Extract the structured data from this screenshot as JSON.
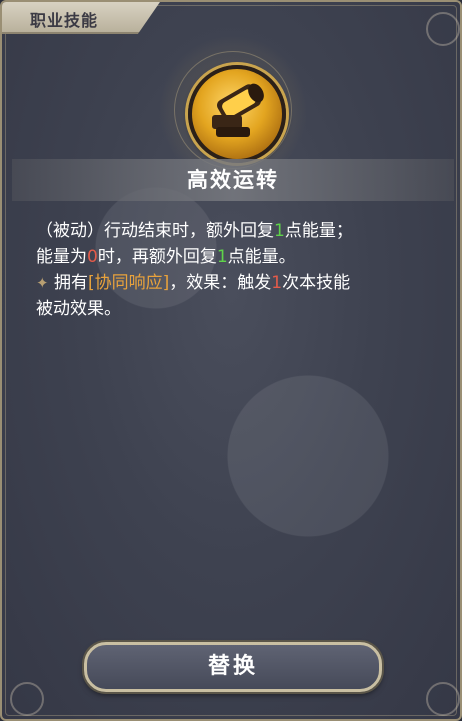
{
  "tab": {
    "label": "职业技能"
  },
  "skill": {
    "icon": "golden-cannon-icon",
    "name": "高效运转",
    "line1": {
      "a": "（被动）行动结束时，额外回复",
      "b": "1",
      "c": "点能量；"
    },
    "line2": {
      "a": "能量为",
      "b": "0",
      "c": "时，再额外回复",
      "d": "1",
      "e": "点能量。"
    },
    "line3": {
      "star": "✦",
      "a": "拥有",
      "b": "[协同响应]",
      "c": "，效果：触发",
      "d": "1",
      "e": "次本技能"
    },
    "line4": "被动效果。"
  },
  "button": {
    "replace_label": "替换"
  },
  "colors": {
    "highlight_green": "#5fd34a",
    "highlight_red": "#e35b4a",
    "highlight_orange": "#e8a23c"
  }
}
